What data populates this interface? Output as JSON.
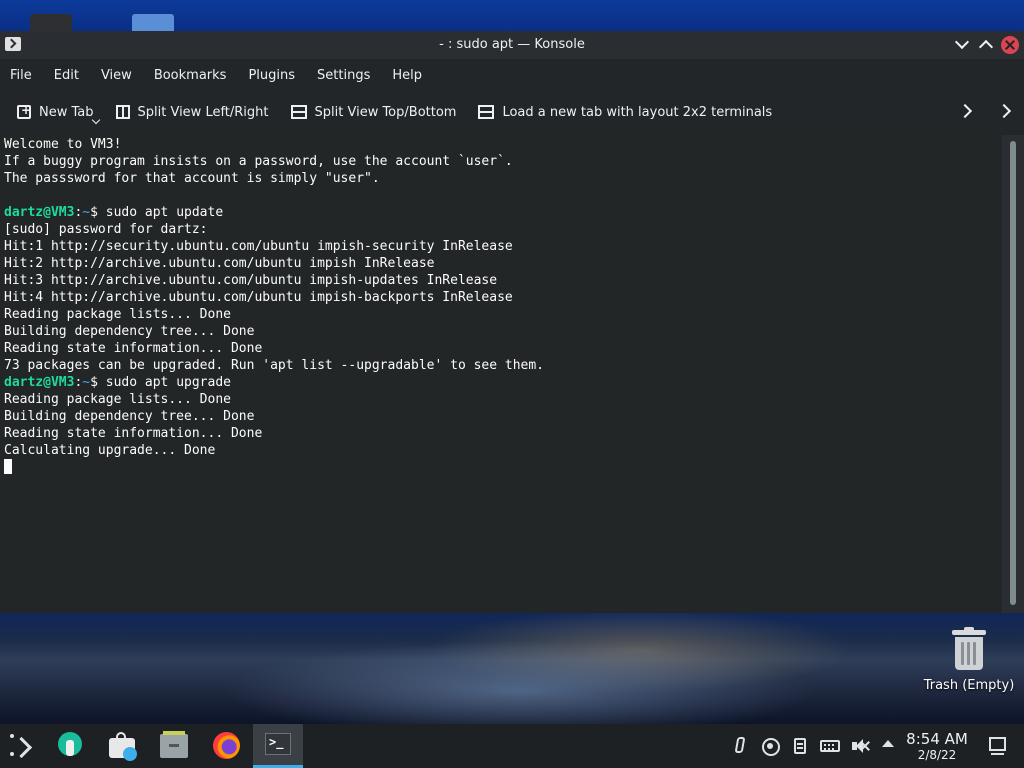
{
  "window": {
    "title": "- : sudo apt — Konsole"
  },
  "menubar": {
    "items": [
      "File",
      "Edit",
      "View",
      "Bookmarks",
      "Plugins",
      "Settings",
      "Help"
    ]
  },
  "toolbar": {
    "new_tab": "New Tab",
    "split_lr": "Split View Left/Right",
    "split_tb": "Split View Top/Bottom",
    "load_layout": "Load a new tab with layout 2x2 terminals"
  },
  "terminal": {
    "prompt_user": "dartz@VM3",
    "prompt_path": "~",
    "lines": [
      {
        "text": "Welcome to VM3!"
      },
      {
        "text": "If a buggy program insists on a password, use the account `user`."
      },
      {
        "text": "The passsword for that account is simply \"user\"."
      },
      {
        "text": ""
      },
      {
        "cmd": "sudo apt update"
      },
      {
        "text": "[sudo] password for dartz:"
      },
      {
        "text": "Hit:1 http://security.ubuntu.com/ubuntu impish-security InRelease"
      },
      {
        "text": "Hit:2 http://archive.ubuntu.com/ubuntu impish InRelease"
      },
      {
        "text": "Hit:3 http://archive.ubuntu.com/ubuntu impish-updates InRelease"
      },
      {
        "text": "Hit:4 http://archive.ubuntu.com/ubuntu impish-backports InRelease"
      },
      {
        "text": "Reading package lists... Done"
      },
      {
        "text": "Building dependency tree... Done"
      },
      {
        "text": "Reading state information... Done"
      },
      {
        "text": "73 packages can be upgraded. Run 'apt list --upgradable' to see them."
      },
      {
        "cmd": "sudo apt upgrade"
      },
      {
        "text": "Reading package lists... Done"
      },
      {
        "text": "Building dependency tree... Done"
      },
      {
        "text": "Reading state information... Done"
      },
      {
        "text": "Calculating upgrade... Done"
      }
    ]
  },
  "desktop": {
    "trash_label": "Trash (Empty)"
  },
  "taskbar": {
    "time": "8:54 AM",
    "date": "2/8/22"
  },
  "colors": {
    "accent": "#3daee9",
    "prompt_user": "#1cdc9a",
    "close_button": "#da4453"
  }
}
